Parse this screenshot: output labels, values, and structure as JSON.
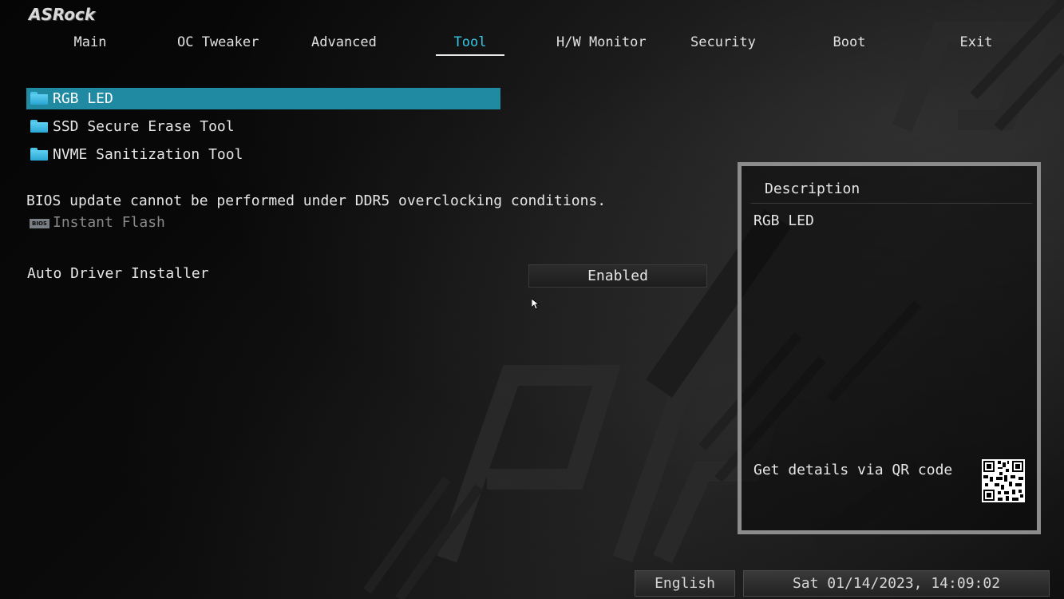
{
  "brand": {
    "logo_text": "ASRock"
  },
  "tabs": [
    {
      "label": "Main"
    },
    {
      "label": "OC Tweaker"
    },
    {
      "label": "Advanced"
    },
    {
      "label": "Tool",
      "active": true
    },
    {
      "label": "H/W Monitor"
    },
    {
      "label": "Security"
    },
    {
      "label": "Boot"
    },
    {
      "label": "Exit"
    }
  ],
  "menu": {
    "items": [
      {
        "label": "RGB LED",
        "icon": "folder-icon",
        "selected": true
      },
      {
        "label": "SSD Secure Erase Tool",
        "icon": "folder-icon"
      },
      {
        "label": "NVME Sanitization Tool",
        "icon": "folder-icon"
      }
    ]
  },
  "notice": "BIOS update cannot be performed under DDR5 overclocking conditions.",
  "instant_flash": {
    "icon_text": "BIOS",
    "label": "Instant Flash",
    "disabled": true
  },
  "settings": [
    {
      "label": "Auto Driver Installer",
      "value": "Enabled"
    }
  ],
  "description": {
    "title": "Description",
    "text": "RGB LED",
    "qr_label": "Get details via QR code"
  },
  "status_bar": {
    "language": "English",
    "datetime": "Sat 01/14/2023, 14:09:02"
  },
  "colors": {
    "accent": "#34c6e6",
    "selection": "#1f8aa2",
    "background": "#000000"
  }
}
